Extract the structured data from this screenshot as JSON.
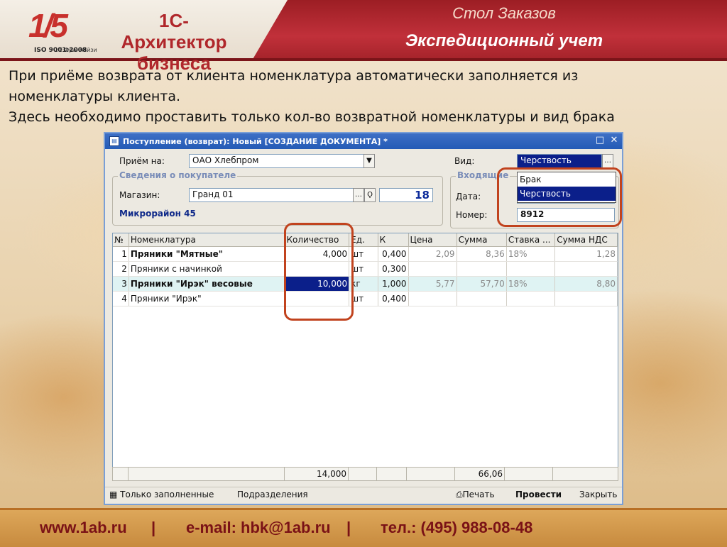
{
  "header": {
    "logo_number": "1/5",
    "logo_sub": "1С:Франчайзи",
    "logo_iso": "ISO 9001:2008",
    "brand_line1": "1С-Архитектор",
    "brand_line2": "бизнеса",
    "title1": "Стол Заказов",
    "title2": "Экспедиционный учет"
  },
  "caption": {
    "line1": "При приёме возврата от клиента номенклатура автоматически заполняется из",
    "line2": "номенклатуры клиента.",
    "line3": "Здесь необходимо проставить только кол-во возвратной номенклатуры и вид брака"
  },
  "window": {
    "title": "Поступление (возврат): Новый [СОЗДАНИЕ ДОКУМЕНТА] *",
    "priem_label": "Приём на:",
    "priem_value": "ОАО Хлебпром",
    "vid_label": "Вид:",
    "vid_value": "Черствость",
    "buyer_group": "Сведения о покупателе",
    "store_label": "Магазин:",
    "store_value": "Гранд 01",
    "store_code": "18",
    "district": "Микрорайон 45",
    "incoming_group": "Входящие",
    "date_label": "Дата:",
    "number_label": "Номер:",
    "number_value": "8912",
    "dropdown_options": [
      "Брак",
      "Черствость"
    ],
    "dropdown_selected": "Черствость"
  },
  "table": {
    "columns": [
      "№",
      "Номенклатура",
      "Количество",
      "Ед.",
      "К",
      "Цена",
      "Сумма",
      "Ставка ...",
      "Сумма НДС"
    ],
    "rows": [
      {
        "n": "1",
        "name": "Пряники \"Мятные\"",
        "qty": "4,000",
        "unit": "шт",
        "k": "0,400",
        "price": "2,09",
        "sum": "8,36",
        "rate": "18%",
        "vat": "1,28"
      },
      {
        "n": "2",
        "name": "Пряники с начинкой",
        "qty": "",
        "unit": "шт",
        "k": "0,300",
        "price": "",
        "sum": "",
        "rate": "",
        "vat": ""
      },
      {
        "n": "3",
        "name": "Пряники \"Ирэк\" весовые",
        "qty": "10,000",
        "unit": "кг",
        "k": "1,000",
        "price": "5,77",
        "sum": "57,70",
        "rate": "18%",
        "vat": "8,80"
      },
      {
        "n": "4",
        "name": "Пряники \"Ирэк\"",
        "qty": "",
        "unit": "шт",
        "k": "0,400",
        "price": "",
        "sum": "",
        "rate": "",
        "vat": ""
      }
    ],
    "total_qty": "14,000",
    "total_sum": "66,06"
  },
  "bottombar": {
    "only_filled": "Только заполненные",
    "divisions": "Подразделения",
    "print": "Печать",
    "post": "Провести",
    "close": "Закрыть"
  },
  "footer": {
    "site": "www.1ab.ru",
    "sep": "|",
    "email": "e-mail: hbk@1ab.ru",
    "phone": "тел.: (495) 988-08-48"
  }
}
